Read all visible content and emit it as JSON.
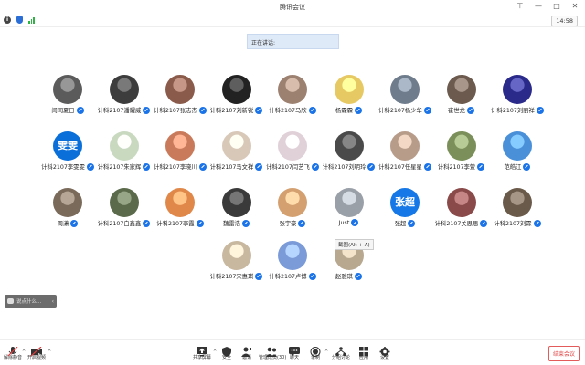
{
  "window": {
    "title": "腾讯会议"
  },
  "info": {
    "timer": "14:58"
  },
  "speaking": {
    "label": "正在讲话:"
  },
  "tooltip": "截图(Alt + A)",
  "chat": {
    "placeholder": "说点什么..."
  },
  "participants": [
    {
      "name": "闫闫夏日",
      "type": "photo",
      "color": "#5b5b5b"
    },
    {
      "name": "计科2107潘耀威",
      "type": "photo",
      "color": "#3d3d3d"
    },
    {
      "name": "计科2107张志杰",
      "type": "photo",
      "color": "#8a5a4a"
    },
    {
      "name": "计科2107刘新锐",
      "type": "photo",
      "color": "#222222"
    },
    {
      "name": "计科2107马欣",
      "type": "photo",
      "color": "#9c8070"
    },
    {
      "name": "杨霖霖",
      "type": "photo",
      "color": "#e7c964"
    },
    {
      "name": "计科2107杨少华",
      "type": "photo",
      "color": "#6f7c8c"
    },
    {
      "name": "崔世龙",
      "type": "photo",
      "color": "#6b5a4d"
    },
    {
      "name": "计科2107刘丽祥",
      "type": "photo",
      "color": "#2a2a8a"
    },
    {
      "name": "计科2107李雯雯",
      "type": "text",
      "text": "雯雯"
    },
    {
      "name": "计科2107朱家辉",
      "type": "photo",
      "color": "#c9d9c0"
    },
    {
      "name": "计科2107李晓川",
      "type": "photo",
      "color": "#c97a5a"
    },
    {
      "name": "计科2107马文祥",
      "type": "photo",
      "color": "#d8c8b8"
    },
    {
      "name": "计科2107闫艺飞",
      "type": "photo",
      "color": "#e0d0d8"
    },
    {
      "name": "计科2107刘明玲",
      "type": "photo",
      "color": "#4a4a4a"
    },
    {
      "name": "计科2107任星星",
      "type": "photo",
      "color": "#b89c8a"
    },
    {
      "name": "计科2107李萱",
      "type": "photo",
      "color": "#7b8f5a"
    },
    {
      "name": "范皓江",
      "type": "photo",
      "color": "#4a90d9"
    },
    {
      "name": "周潇",
      "type": "photo",
      "color": "#7a6a5a"
    },
    {
      "name": "计科2107白鑫鑫",
      "type": "photo",
      "color": "#5a6a4a"
    },
    {
      "name": "计科2107李霞",
      "type": "photo",
      "color": "#e0884a"
    },
    {
      "name": "魏雷浩",
      "type": "photo",
      "color": "#3a3a3a"
    },
    {
      "name": "张宇豪",
      "type": "photo",
      "color": "#d4a070"
    },
    {
      "name": "Just",
      "type": "photo",
      "color": "#9aa0a8"
    },
    {
      "name": "张超",
      "type": "text2",
      "text": "张超"
    },
    {
      "name": "计科2107关思思",
      "type": "photo",
      "color": "#8a4a4a"
    },
    {
      "name": "计科2107刘霖",
      "type": "photo",
      "color": "#6a5a4a"
    },
    {
      "name": "计科2107宋惠琪",
      "type": "photo",
      "color": "#c8b8a0"
    },
    {
      "name": "计科2107卢博",
      "type": "photo",
      "color": "#7a9ad8"
    },
    {
      "name": "赵雅琪",
      "type": "photo",
      "color": "#b8a890"
    }
  ],
  "toolbar": {
    "mute": "解除静音",
    "video": "开启视频",
    "share": "共享屏幕",
    "security": "安全",
    "invite": "邀请",
    "members": "管理成员(30)",
    "chat": "聊天",
    "record": "录制",
    "breakout": "分组讨论",
    "apps": "应用",
    "settings": "设置",
    "end": "结束会议"
  }
}
